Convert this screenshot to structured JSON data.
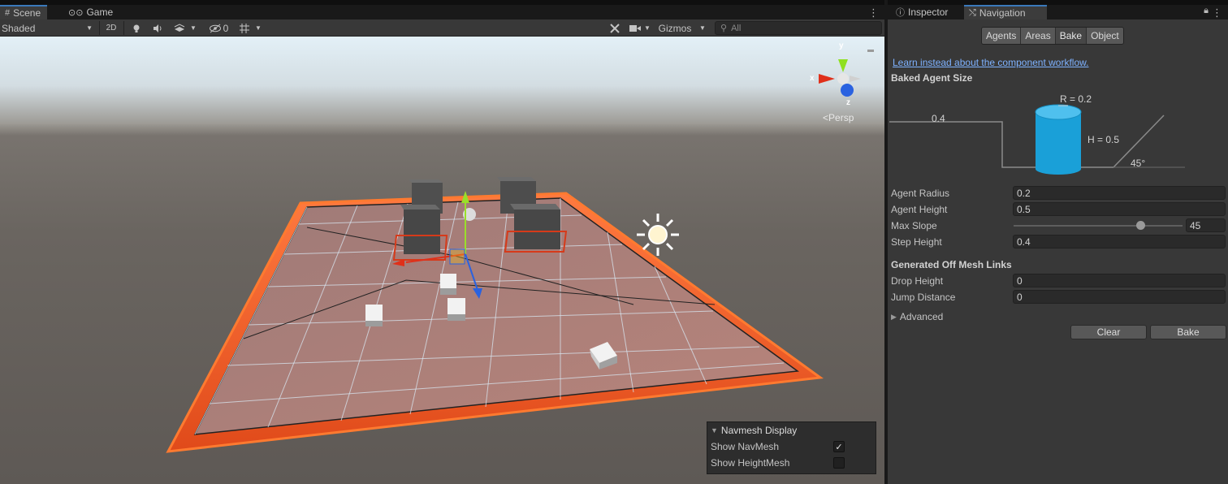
{
  "scene": {
    "tabs": [
      {
        "label": "Scene"
      },
      {
        "label": "Game"
      }
    ],
    "toolbar": {
      "shading_mode": "Shaded",
      "toggle_2d": "2D",
      "hidden_count": "0",
      "gizmos_label": "Gizmos",
      "search_placeholder": "All"
    },
    "gizmo": {
      "x_label": "x",
      "y_label": "y",
      "z_label": "z",
      "projection": "Persp"
    },
    "navmesh_overlay": {
      "title": "Navmesh Display",
      "rows": [
        {
          "label": "Show NavMesh",
          "checked": true,
          "mark": "✓"
        },
        {
          "label": "Show HeightMesh",
          "checked": false,
          "mark": ""
        }
      ]
    }
  },
  "navigation": {
    "tabs": [
      {
        "label": "Inspector"
      },
      {
        "label": "Navigation"
      }
    ],
    "subtabs": [
      {
        "label": "Agents"
      },
      {
        "label": "Areas"
      },
      {
        "label": "Bake"
      },
      {
        "label": "Object"
      }
    ],
    "selected_subtab": "Bake",
    "workflow_link": "Learn instead about the component workflow.",
    "baked_agent_size": {
      "title": "Baked Agent Size",
      "step_label": "0.4",
      "radius_label": "R = 0.2",
      "height_label": "H = 0.5",
      "slope_label": "45°"
    },
    "properties": [
      {
        "label": "Agent Radius",
        "value": "0.2"
      },
      {
        "label": "Agent Height",
        "value": "0.5"
      },
      {
        "label": "Max Slope",
        "value": "45",
        "slider_fraction": 0.75
      },
      {
        "label": "Step Height",
        "value": "0.4"
      }
    ],
    "off_mesh": {
      "title": "Generated Off Mesh Links",
      "properties": [
        {
          "label": "Drop Height",
          "value": "0"
        },
        {
          "label": "Jump Distance",
          "value": "0"
        }
      ]
    },
    "advanced_label": "Advanced",
    "buttons": {
      "clear": "Clear",
      "bake": "Bake"
    }
  },
  "colors": {
    "accent_tab": "#3a79bb",
    "navmesh_outline": "#ff6a1f",
    "agent_cylinder": "#1aa0d8",
    "link": "#7eb2ff"
  }
}
